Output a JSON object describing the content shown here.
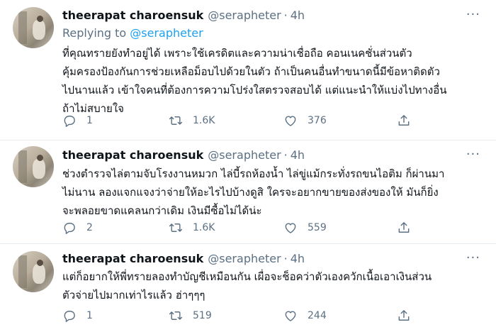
{
  "tweets": [
    {
      "name": "theerapat charoensuk",
      "handle": "@serapheter",
      "dot": "·",
      "time": "4h",
      "more": "···",
      "replying_prefix": "Replying to ",
      "replying_mention": "@serapheter",
      "text": "ที่คุณทรายยังทำอยู่ได้ เพราะใช้เครดิตและความน่าเชื่อถือ คอนเนคชั่นส่วนตัว\nคุ้มครองป้องกันการช่วยเหลือม็อบไปด้วยในตัว ถ้าเป็นคนอื่นทำขนาดนี้มีข้อหาติดตัว\nไปนานแล้ว เข้าใจคนที่ต้องการความโปร่งใสตรวจสอบได้ แต่แนะนำให้แบ่งไปทางอื่น\nถ้าไม่สบายใจ",
      "replies": "1",
      "retweets": "1.6K",
      "likes": "376"
    },
    {
      "name": "theerapat charoensuk",
      "handle": "@serapheter",
      "dot": "·",
      "time": "4h",
      "more": "···",
      "text": "ช่วงตำรวจไล่ตามจับโรงงานหมวก ไล่บี้รถห้องน้ำ ไล่ขู่แม้กระทั่งรถขนไอติม ก็ผ่านมา\nไม่นาน ลองแจกแจงว่าจ่ายให้อะไรไปบ้างดูสิ ใครจะอยากขายของส่งของให้ มันก็ยิ่ง\nจะพลอยขาดแคลนกว่าเดิม เงินมีซื้อไม่ได้น่ะ",
      "replies": "2",
      "retweets": "1.6K",
      "likes": "559"
    },
    {
      "name": "theerapat charoensuk",
      "handle": "@serapheter",
      "dot": "·",
      "time": "4h",
      "more": "···",
      "text": "แต่ก็อยากให้พี่ทรายลองทำบัญชีเหมือนกัน เผื่อจะช็อคว่าตัวเองควักเนื้อเอาเงินส่วน\nตัวจ่ายไปมากเท่าไรแล้ว ฮ่าๆๆๆ",
      "replies": "1",
      "retweets": "519",
      "likes": "244"
    }
  ],
  "icons": {
    "reply": "reply-icon",
    "retweet": "retweet-icon",
    "like": "like-icon",
    "share": "share-icon"
  }
}
